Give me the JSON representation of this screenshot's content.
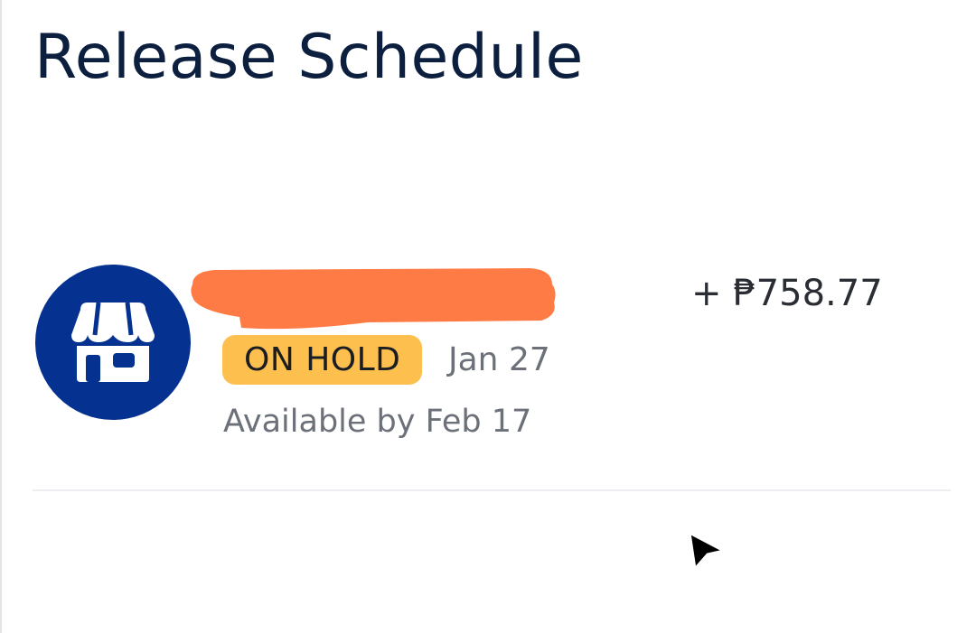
{
  "page": {
    "title": "Release Schedule"
  },
  "transaction": {
    "icon": "storefront-icon",
    "merchant_name_redacted": true,
    "status": "ON HOLD",
    "date": "Jan 27",
    "availability": "Available by Feb 17",
    "amount": "+ ₱758.77"
  },
  "colors": {
    "title": "#0c1f3f",
    "avatar_bg": "#053290",
    "badge_bg": "#fdc04f",
    "redaction": "#ff7b45",
    "muted_text": "#6b7079",
    "amount_text": "#2a2d33",
    "divider": "#eceef1"
  },
  "cursor": {
    "icon": "pointer-arrow-icon"
  }
}
